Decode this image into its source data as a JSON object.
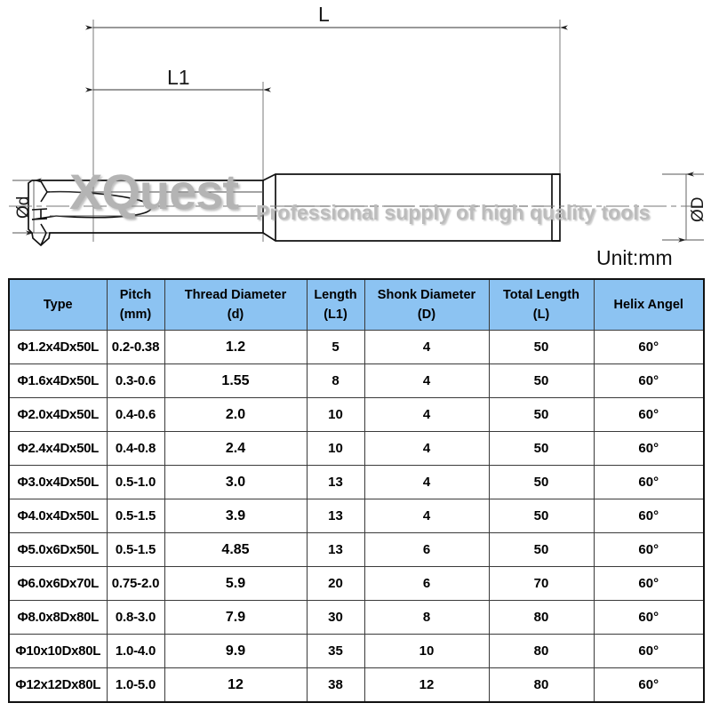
{
  "drawing": {
    "dimension_labels": {
      "overall_length": "L",
      "thread_length": "L1",
      "thread_diameter": "Ød",
      "shank_diameter": "ØD"
    },
    "unit_note": "Unit:mm",
    "watermark": {
      "brand": "XQuest",
      "tagline": "Professional supply of high quality tools"
    }
  },
  "table": {
    "columns": [
      {
        "title": "Type",
        "sub": ""
      },
      {
        "title": "Pitch",
        "sub": "(mm)"
      },
      {
        "title": "Thread Diameter",
        "sub": "(d)"
      },
      {
        "title": "Length",
        "sub": "(L1)"
      },
      {
        "title": "Shonk Diameter",
        "sub": "(D)"
      },
      {
        "title": "Total Length",
        "sub": "(L)"
      },
      {
        "title": "Helix Angel",
        "sub": ""
      }
    ],
    "rows": [
      {
        "type": "Φ1.2x4Dx50L",
        "pitch": "0.2-0.38",
        "thread_diameter": "1.2",
        "length_l1": "5",
        "shank_diameter": "4",
        "total_length": "50",
        "helix_angle": "60°"
      },
      {
        "type": "Φ1.6x4Dx50L",
        "pitch": "0.3-0.6",
        "thread_diameter": "1.55",
        "length_l1": "8",
        "shank_diameter": "4",
        "total_length": "50",
        "helix_angle": "60°"
      },
      {
        "type": "Φ2.0x4Dx50L",
        "pitch": "0.4-0.6",
        "thread_diameter": "2.0",
        "length_l1": "10",
        "shank_diameter": "4",
        "total_length": "50",
        "helix_angle": "60°"
      },
      {
        "type": "Φ2.4x4Dx50L",
        "pitch": "0.4-0.8",
        "thread_diameter": "2.4",
        "length_l1": "10",
        "shank_diameter": "4",
        "total_length": "50",
        "helix_angle": "60°"
      },
      {
        "type": "Φ3.0x4Dx50L",
        "pitch": "0.5-1.0",
        "thread_diameter": "3.0",
        "length_l1": "13",
        "shank_diameter": "4",
        "total_length": "50",
        "helix_angle": "60°"
      },
      {
        "type": "Φ4.0x4Dx50L",
        "pitch": "0.5-1.5",
        "thread_diameter": "3.9",
        "length_l1": "13",
        "shank_diameter": "4",
        "total_length": "50",
        "helix_angle": "60°"
      },
      {
        "type": "Φ5.0x6Dx50L",
        "pitch": "0.5-1.5",
        "thread_diameter": "4.85",
        "length_l1": "13",
        "shank_diameter": "6",
        "total_length": "50",
        "helix_angle": "60°"
      },
      {
        "type": "Φ6.0x6Dx70L",
        "pitch": "0.75-2.0",
        "thread_diameter": "5.9",
        "length_l1": "20",
        "shank_diameter": "6",
        "total_length": "70",
        "helix_angle": "60°"
      },
      {
        "type": "Φ8.0x8Dx80L",
        "pitch": "0.8-3.0",
        "thread_diameter": "7.9",
        "length_l1": "30",
        "shank_diameter": "8",
        "total_length": "80",
        "helix_angle": "60°"
      },
      {
        "type": "Φ10x10Dx80L",
        "pitch": "1.0-4.0",
        "thread_diameter": "9.9",
        "length_l1": "35",
        "shank_diameter": "10",
        "total_length": "80",
        "helix_angle": "60°"
      },
      {
        "type": "Φ12x12Dx80L",
        "pitch": "1.0-5.0",
        "thread_diameter": "12",
        "length_l1": "38",
        "shank_diameter": "12",
        "total_length": "80",
        "helix_angle": "60°"
      }
    ]
  },
  "colors": {
    "header_fill": "#8cc3f2",
    "line": "#111111",
    "watermark": "#b4b4b4"
  }
}
